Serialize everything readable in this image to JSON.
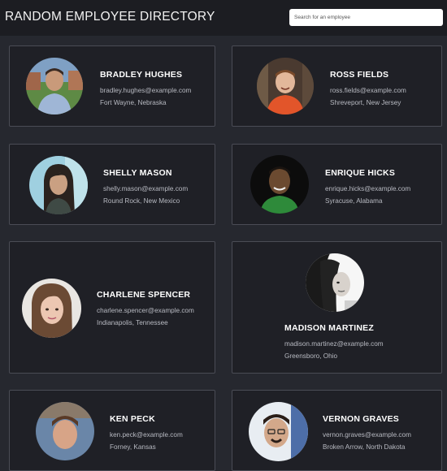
{
  "header": {
    "title": "RANDOM EMPLOYEE DIRECTORY",
    "search_placeholder": "Search for an employee",
    "search_value": ""
  },
  "colors": {
    "background": "#26282f",
    "header": "#1c1d22",
    "card": "#1f2026",
    "card_border": "#4a4c55",
    "secondary_text": "#b8bac2"
  },
  "employees": [
    {
      "name": "BRADLEY HUGHES",
      "email": "bradley.hughes@example.com",
      "location": "Fort Wayne, Nebraska"
    },
    {
      "name": "ROSS FIELDS",
      "email": "ross.fields@example.com",
      "location": "Shreveport, New Jersey"
    },
    {
      "name": "SHELLY MASON",
      "email": "shelly.mason@example.com",
      "location": "Round Rock, New Mexico"
    },
    {
      "name": "ENRIQUE HICKS",
      "email": "enrique.hicks@example.com",
      "location": "Syracuse, Alabama"
    },
    {
      "name": "CHARLENE SPENCER",
      "email": "charlene.spencer@example.com",
      "location": "Indianapolis, Tennessee"
    },
    {
      "name": "MADISON MARTINEZ",
      "email": "madison.martinez@example.com",
      "location": "Greensboro, Ohio"
    },
    {
      "name": "KEN PECK",
      "email": "ken.peck@example.com",
      "location": "Forney, Kansas"
    },
    {
      "name": "VERNON GRAVES",
      "email": "vernon.graves@example.com",
      "location": "Broken Arrow, North Dakota"
    }
  ]
}
